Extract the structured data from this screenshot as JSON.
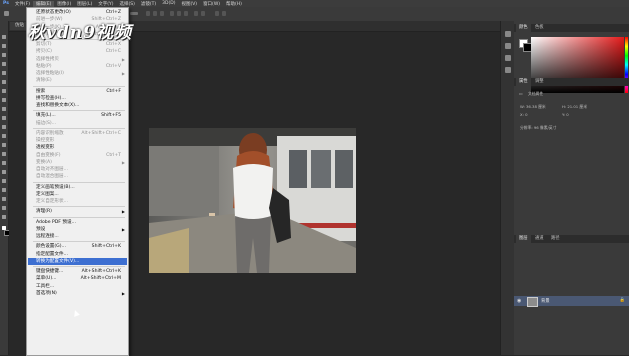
{
  "menubar": {
    "items": [
      "文件(F)",
      "编辑(E)",
      "图像(I)",
      "图层(L)",
      "文字(Y)",
      "选择(S)",
      "滤镜(T)",
      "3D(D)",
      "视图(V)",
      "窗口(W)",
      "帮助(H)"
    ]
  },
  "document_tab": {
    "label": "仿贴"
  },
  "watermark": {
    "text": "秋vdn9视频"
  },
  "edit_menu": {
    "items": [
      {
        "label": "还原状态更改(O)",
        "shortcut": "Ctrl+Z",
        "disabled": false
      },
      {
        "label": "前进一步(W)",
        "shortcut": "Shift+Ctrl+Z",
        "disabled": true
      },
      {
        "label": "后退一步(K)",
        "shortcut": "Alt+Ctrl+Z",
        "disabled": true
      },
      {
        "label": "渐隐(D)...",
        "shortcut": "Shift+Ctrl+F",
        "disabled": true
      },
      {
        "sep": true
      },
      {
        "label": "剪切(T)",
        "shortcut": "Ctrl+X",
        "disabled": true
      },
      {
        "label": "拷贝(C)",
        "shortcut": "Ctrl+C",
        "disabled": true
      },
      {
        "label": "选择性拷贝",
        "shortcut": "",
        "arrow": true,
        "disabled": true
      },
      {
        "label": "粘贴(P)",
        "shortcut": "Ctrl+V",
        "disabled": true
      },
      {
        "label": "选择性粘贴(I)",
        "shortcut": "",
        "arrow": true,
        "disabled": true
      },
      {
        "label": "清除(E)",
        "shortcut": "",
        "disabled": true
      },
      {
        "sep": true
      },
      {
        "label": "搜索",
        "shortcut": "Ctrl+F",
        "disabled": false
      },
      {
        "label": "拼写检查(H)...",
        "shortcut": "",
        "disabled": false
      },
      {
        "label": "查找和替换文本(X)...",
        "shortcut": "",
        "disabled": false
      },
      {
        "sep": true
      },
      {
        "label": "填充(L)...",
        "shortcut": "Shift+F5",
        "disabled": false
      },
      {
        "label": "描边(S)...",
        "shortcut": "",
        "disabled": true
      },
      {
        "sep": true
      },
      {
        "label": "内容识别缩放",
        "shortcut": "Alt+Shift+Ctrl+C",
        "disabled": true
      },
      {
        "label": "操控变形",
        "shortcut": "",
        "disabled": true
      },
      {
        "label": "透视变形",
        "shortcut": "",
        "disabled": false
      },
      {
        "label": "自由变换(F)",
        "shortcut": "Ctrl+T",
        "disabled": true
      },
      {
        "label": "变换(A)",
        "shortcut": "",
        "arrow": true,
        "disabled": true
      },
      {
        "label": "自动对齐图层...",
        "shortcut": "",
        "disabled": true
      },
      {
        "label": "自动混合图层...",
        "shortcut": "",
        "disabled": true
      },
      {
        "sep": true
      },
      {
        "label": "定义画笔预设(B)...",
        "shortcut": "",
        "disabled": false
      },
      {
        "label": "定义图案...",
        "shortcut": "",
        "disabled": false
      },
      {
        "label": "定义自定形状...",
        "shortcut": "",
        "disabled": true
      },
      {
        "sep": true
      },
      {
        "label": "清理(R)",
        "shortcut": "",
        "arrow": true,
        "disabled": false
      },
      {
        "sep": true
      },
      {
        "label": "Adobe PDF 预设...",
        "shortcut": "",
        "disabled": false
      },
      {
        "label": "预设",
        "shortcut": "",
        "arrow": true,
        "disabled": false
      },
      {
        "label": "远程连接...",
        "shortcut": "",
        "disabled": false
      },
      {
        "sep": true
      },
      {
        "label": "颜色设置(G)...",
        "shortcut": "Shift+Ctrl+K",
        "disabled": false
      },
      {
        "label": "指定配置文件...",
        "shortcut": "",
        "disabled": false
      },
      {
        "label": "转换为配置文件(V)...",
        "shortcut": "",
        "disabled": false,
        "highlight": true
      },
      {
        "sep": true
      },
      {
        "label": "键盘快捷键...",
        "shortcut": "Alt+Shift+Ctrl+K",
        "disabled": false
      },
      {
        "label": "菜单(U)...",
        "shortcut": "Alt+Shift+Ctrl+M",
        "disabled": false
      },
      {
        "label": "工具栏...",
        "shortcut": "",
        "disabled": false
      },
      {
        "label": "首选项(N)",
        "shortcut": "",
        "arrow": true,
        "disabled": false
      }
    ]
  },
  "right_panel": {
    "top_tabs": [
      "颜色",
      "色板"
    ],
    "mid_tabs": [
      "属性",
      "调整"
    ],
    "props_title": "文档属性",
    "w_label": "W: 36.38 厘米",
    "h_label": "H: 21.01 厘米",
    "x_label": "X: 0",
    "y_label": "Y: 0",
    "res_label": "分辨率: 96 像素/英寸",
    "layer_tabs": [
      "图层",
      "通道",
      "路径"
    ],
    "layer_name": "背景"
  },
  "colors": {
    "fg": "#ffffff",
    "bg": "#000000",
    "highlight": "#3d6fd1",
    "layer_selected": "#4a5873"
  }
}
